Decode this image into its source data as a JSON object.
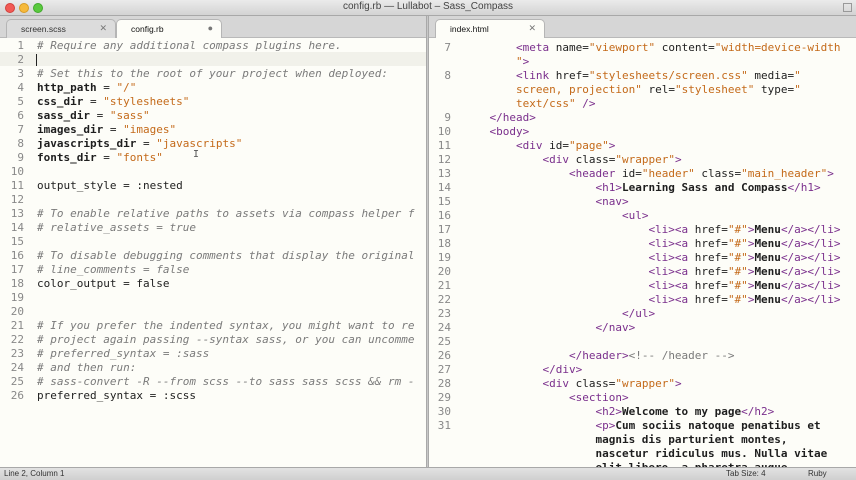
{
  "window": {
    "title": "config.rb — Lullabot – Sass_Compass"
  },
  "tabs_left": [
    {
      "label": "screen.scss",
      "active": false
    },
    {
      "label": "config.rb",
      "active": true
    }
  ],
  "tabs_right": [
    {
      "label": "index.html",
      "active": true
    }
  ],
  "left_editor": {
    "lines": [
      [
        [
          "c",
          "# Require any additional compass plugins here."
        ]
      ],
      [],
      [
        [
          "c",
          "# Set this to the root of your project when deployed:"
        ]
      ],
      [
        [
          "k",
          "http_path"
        ],
        [
          "o",
          " = "
        ],
        [
          "s",
          "\"/\""
        ]
      ],
      [
        [
          "k",
          "css_dir"
        ],
        [
          "o",
          " = "
        ],
        [
          "s",
          "\"stylesheets\""
        ]
      ],
      [
        [
          "k",
          "sass_dir"
        ],
        [
          "o",
          " = "
        ],
        [
          "s",
          "\"sass\""
        ]
      ],
      [
        [
          "k",
          "images_dir"
        ],
        [
          "o",
          " = "
        ],
        [
          "s",
          "\"images\""
        ]
      ],
      [
        [
          "k",
          "javascripts_dir"
        ],
        [
          "o",
          " = "
        ],
        [
          "s",
          "\"javascripts\""
        ]
      ],
      [
        [
          "k",
          "fonts_dir"
        ],
        [
          "o",
          " = "
        ],
        [
          "s",
          "\"fonts\""
        ]
      ],
      [],
      [
        [
          "o",
          "output_style = :nested"
        ]
      ],
      [],
      [
        [
          "c",
          "# To enable relative paths to assets via compass helper f"
        ]
      ],
      [
        [
          "c",
          "# relative_assets = true"
        ]
      ],
      [],
      [
        [
          "c",
          "# To disable debugging comments that display the original"
        ]
      ],
      [
        [
          "c",
          "# line_comments = false"
        ]
      ],
      [
        [
          "o",
          "color_output = false"
        ]
      ],
      [],
      [],
      [
        [
          "c",
          "# If you prefer the indented syntax, you might want to re"
        ]
      ],
      [
        [
          "c",
          "# project again passing --syntax sass, or you can uncomme"
        ]
      ],
      [
        [
          "c",
          "# preferred_syntax = :sass"
        ]
      ],
      [
        [
          "c",
          "# and then run:"
        ]
      ],
      [
        [
          "c",
          "# sass-convert -R --from scss --to sass sass scss && rm -"
        ]
      ],
      [
        [
          "o",
          "preferred_syntax = :scss"
        ]
      ]
    ]
  },
  "right_editor": {
    "rows": [
      {
        "n": "7",
        "t": [
          [
            "o",
            "        "
          ],
          [
            "tag",
            "<meta"
          ],
          [
            "attr",
            " name="
          ],
          [
            "str",
            "\"viewport\""
          ],
          [
            "attr",
            " content="
          ],
          [
            "str",
            "\"width=device-width"
          ]
        ]
      },
      {
        "n": "",
        "t": [
          [
            "o",
            "        "
          ],
          [
            "str",
            "\""
          ],
          [
            "tag",
            ">"
          ]
        ]
      },
      {
        "n": "8",
        "t": [
          [
            "o",
            "        "
          ],
          [
            "tag",
            "<link"
          ],
          [
            "attr",
            " href="
          ],
          [
            "str",
            "\"stylesheets/screen.css\""
          ],
          [
            "attr",
            " media="
          ],
          [
            "str",
            "\""
          ]
        ]
      },
      {
        "n": "",
        "t": [
          [
            "o",
            "        "
          ],
          [
            "str",
            "screen, projection\""
          ],
          [
            "attr",
            " rel="
          ],
          [
            "str",
            "\"stylesheet\""
          ],
          [
            "attr",
            " type="
          ],
          [
            "str",
            "\""
          ]
        ]
      },
      {
        "n": "",
        "t": [
          [
            "o",
            "        "
          ],
          [
            "str",
            "text/css\""
          ],
          [
            "tag",
            " />"
          ]
        ]
      },
      {
        "n": "9",
        "t": [
          [
            "o",
            "    "
          ],
          [
            "tag",
            "</head>"
          ]
        ]
      },
      {
        "n": "10",
        "t": [
          [
            "o",
            "    "
          ],
          [
            "tag",
            "<body>"
          ]
        ]
      },
      {
        "n": "11",
        "t": [
          [
            "o",
            "        "
          ],
          [
            "tag",
            "<div"
          ],
          [
            "attr",
            " id="
          ],
          [
            "str",
            "\"page\""
          ],
          [
            "tag",
            ">"
          ]
        ]
      },
      {
        "n": "12",
        "t": [
          [
            "o",
            "            "
          ],
          [
            "tag",
            "<div"
          ],
          [
            "attr",
            " class="
          ],
          [
            "str",
            "\"wrapper\""
          ],
          [
            "tag",
            ">"
          ]
        ]
      },
      {
        "n": "13",
        "t": [
          [
            "o",
            "                "
          ],
          [
            "tag",
            "<header"
          ],
          [
            "attr",
            " id="
          ],
          [
            "str",
            "\"header\""
          ],
          [
            "attr",
            " class="
          ],
          [
            "str",
            "\"main_header\""
          ],
          [
            "tag",
            ">"
          ]
        ]
      },
      {
        "n": "14",
        "t": [
          [
            "o",
            "                    "
          ],
          [
            "tag",
            "<h1>"
          ],
          [
            "txt",
            "Learning Sass and Compass"
          ],
          [
            "tag",
            "</h1>"
          ]
        ]
      },
      {
        "n": "15",
        "t": [
          [
            "o",
            "                    "
          ],
          [
            "tag",
            "<nav>"
          ]
        ]
      },
      {
        "n": "16",
        "t": [
          [
            "o",
            "                        "
          ],
          [
            "tag",
            "<ul>"
          ]
        ]
      },
      {
        "n": "17",
        "t": [
          [
            "o",
            "                            "
          ],
          [
            "tag",
            "<li><a"
          ],
          [
            "attr",
            " href="
          ],
          [
            "str",
            "\"#\""
          ],
          [
            "tag",
            ">"
          ],
          [
            "txt",
            "Menu"
          ],
          [
            "tag",
            "</a></li>"
          ]
        ]
      },
      {
        "n": "18",
        "t": [
          [
            "o",
            "                            "
          ],
          [
            "tag",
            "<li><a"
          ],
          [
            "attr",
            " href="
          ],
          [
            "str",
            "\"#\""
          ],
          [
            "tag",
            ">"
          ],
          [
            "txt",
            "Menu"
          ],
          [
            "tag",
            "</a></li>"
          ]
        ]
      },
      {
        "n": "19",
        "t": [
          [
            "o",
            "                            "
          ],
          [
            "tag",
            "<li><a"
          ],
          [
            "attr",
            " href="
          ],
          [
            "str",
            "\"#\""
          ],
          [
            "tag",
            ">"
          ],
          [
            "txt",
            "Menu"
          ],
          [
            "tag",
            "</a></li>"
          ]
        ]
      },
      {
        "n": "20",
        "t": [
          [
            "o",
            "                            "
          ],
          [
            "tag",
            "<li><a"
          ],
          [
            "attr",
            " href="
          ],
          [
            "str",
            "\"#\""
          ],
          [
            "tag",
            ">"
          ],
          [
            "txt",
            "Menu"
          ],
          [
            "tag",
            "</a></li>"
          ]
        ]
      },
      {
        "n": "21",
        "t": [
          [
            "o",
            "                            "
          ],
          [
            "tag",
            "<li><a"
          ],
          [
            "attr",
            " href="
          ],
          [
            "str",
            "\"#\""
          ],
          [
            "tag",
            ">"
          ],
          [
            "txt",
            "Menu"
          ],
          [
            "tag",
            "</a></li>"
          ]
        ]
      },
      {
        "n": "22",
        "t": [
          [
            "o",
            "                            "
          ],
          [
            "tag",
            "<li><a"
          ],
          [
            "attr",
            " href="
          ],
          [
            "str",
            "\"#\""
          ],
          [
            "tag",
            ">"
          ],
          [
            "txt",
            "Menu"
          ],
          [
            "tag",
            "</a></li>"
          ]
        ]
      },
      {
        "n": "23",
        "t": [
          [
            "o",
            "                        "
          ],
          [
            "tag",
            "</ul>"
          ]
        ]
      },
      {
        "n": "24",
        "t": [
          [
            "o",
            "                    "
          ],
          [
            "tag",
            "</nav>"
          ]
        ]
      },
      {
        "n": "25",
        "t": []
      },
      {
        "n": "26",
        "t": [
          [
            "o",
            "                "
          ],
          [
            "tag",
            "</header>"
          ],
          [
            "com",
            "<!-- /header -->"
          ]
        ]
      },
      {
        "n": "27",
        "t": [
          [
            "o",
            "            "
          ],
          [
            "tag",
            "</div>"
          ]
        ]
      },
      {
        "n": "28",
        "t": [
          [
            "o",
            "            "
          ],
          [
            "tag",
            "<div"
          ],
          [
            "attr",
            " class="
          ],
          [
            "str",
            "\"wrapper\""
          ],
          [
            "tag",
            ">"
          ]
        ]
      },
      {
        "n": "29",
        "t": [
          [
            "o",
            "                "
          ],
          [
            "tag",
            "<section>"
          ]
        ]
      },
      {
        "n": "30",
        "t": [
          [
            "o",
            "                    "
          ],
          [
            "tag",
            "<h2>"
          ],
          [
            "txt",
            "Welcome to my page"
          ],
          [
            "tag",
            "</h2>"
          ]
        ]
      },
      {
        "n": "31",
        "t": [
          [
            "o",
            "                    "
          ],
          [
            "tag",
            "<p>"
          ],
          [
            "txt",
            "Cum sociis natoque penatibus et"
          ]
        ]
      },
      {
        "n": "",
        "t": [
          [
            "o",
            "                    "
          ],
          [
            "txt",
            "magnis dis parturient montes,"
          ]
        ]
      },
      {
        "n": "",
        "t": [
          [
            "o",
            "                    "
          ],
          [
            "txt",
            "nascetur ridiculus mus. Nulla vitae"
          ]
        ]
      },
      {
        "n": "",
        "t": [
          [
            "o",
            "                    "
          ],
          [
            "txt",
            "elit libero, a pharetra augue."
          ]
        ]
      }
    ]
  },
  "status": {
    "position": "Line 2, Column 1",
    "tab_size": "Tab Size: 4",
    "syntax": "Ruby"
  }
}
